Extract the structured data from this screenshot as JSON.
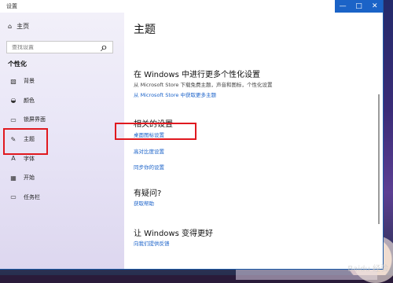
{
  "window": {
    "title": "设置",
    "controls": {
      "minimize": "—",
      "maximize": "□",
      "close": "✕"
    }
  },
  "sidebar": {
    "home_label": "主页",
    "search": {
      "placeholder": "查找设置"
    },
    "section_title": "个性化",
    "items": [
      {
        "label": "背景",
        "icon": "picture-icon"
      },
      {
        "label": "颜色",
        "icon": "palette-icon"
      },
      {
        "label": "锁屏界面",
        "icon": "lock-screen-icon"
      },
      {
        "label": "主题",
        "icon": "brush-icon",
        "selected": true
      },
      {
        "label": "字体",
        "icon": "font-icon"
      },
      {
        "label": "开始",
        "icon": "start-icon"
      },
      {
        "label": "任务栏",
        "icon": "taskbar-icon"
      }
    ]
  },
  "main": {
    "title": "主题",
    "more_title": "在 Windows 中进行更多个性化设置",
    "more_desc": "从 Microsoft Store 下载免费主题，声音和图标，个性化设置",
    "more_link": "从 Microsoft Store 中获取更多主题",
    "related_title": "相关的设置",
    "related_links": [
      "桌面图标设置",
      "高对比度设置",
      "同步你的设置"
    ],
    "question_title": "有疑问?",
    "question_link": "获取帮助",
    "improve_title": "让 Windows 变得更好",
    "improve_link": "向我们提供反馈"
  },
  "watermark": "Baidu 经验"
}
